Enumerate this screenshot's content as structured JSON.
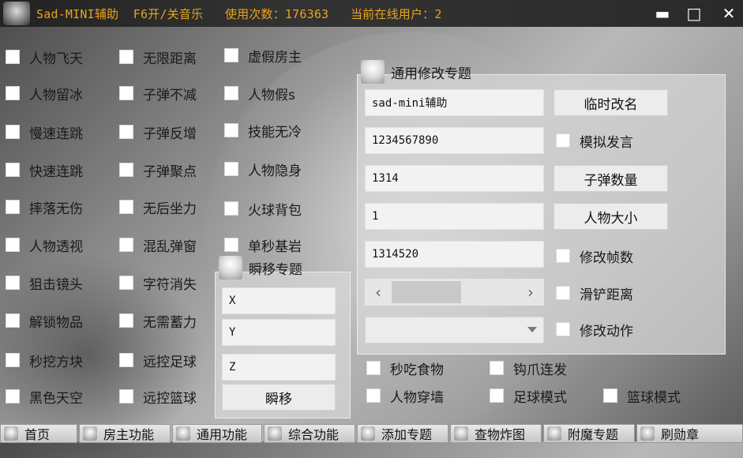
{
  "app": {
    "title": "Sad-MINI辅助  F6开/关音乐   使用次数：176363   当前在线用户：2",
    "minimize": "▬",
    "maximize": "□",
    "close": "✕"
  },
  "col1": [
    "人物飞天",
    "人物留冰",
    "慢速连跳",
    "快速连跳",
    "摔落无伤",
    "人物透视",
    "狙击镜头",
    "解锁物品",
    "秒挖方块",
    "黑色天空"
  ],
  "col2": [
    "无限距离",
    "子弹不减",
    "子弹反增",
    "子弹聚点",
    "无后坐力",
    "混乱弹窗",
    "字符消失",
    "无需蓄力",
    "远控足球",
    "远控篮球"
  ],
  "col3": [
    "虚假房主",
    "人物假s",
    "技能无冷",
    "人物隐身",
    "火球背包",
    "单秒基岩"
  ],
  "teleport": {
    "title": "瞬移专题",
    "x": "X",
    "y": "Y",
    "z": "Z",
    "button": "瞬移"
  },
  "general": {
    "title": "通用修改专题",
    "name_value": "sad-mini辅助",
    "rename_button": "临时改名",
    "text_value": "1234567890",
    "simulate_chat": "模拟发言",
    "bullet_value": "1314",
    "bullet_button": "子弹数量",
    "size_value": "1",
    "size_button": "人物大小",
    "fps_value": "1314520",
    "fps_label": "修改帧数",
    "shovel_label": "滑铲距离",
    "action_label": "修改动作",
    "scroll_left": "‹",
    "scroll_right": "›"
  },
  "extra": [
    "秒吃食物",
    "钩爪连发",
    "人物穿墙",
    "足球模式",
    "篮球模式"
  ],
  "tabs": [
    "首页",
    "房主功能",
    "通用功能",
    "综合功能",
    "添加专题",
    "查物炸图",
    "附魔专题",
    "刷勋章"
  ]
}
